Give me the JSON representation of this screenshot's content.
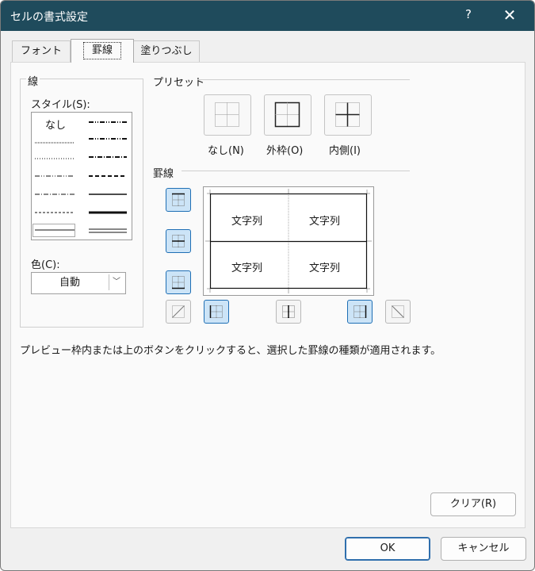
{
  "window": {
    "title": "セルの書式設定",
    "help_label": "?",
    "close_label": "✕"
  },
  "tabs": [
    {
      "label": "フォント"
    },
    {
      "label": "罫線"
    },
    {
      "label": "塗りつぶし"
    }
  ],
  "line_group": {
    "title": "線",
    "style_label": "スタイル(S):",
    "style_none": "なし",
    "color_label": "色(C):",
    "color_value": "自動"
  },
  "preset_group": {
    "title": "プリセット",
    "presets": [
      {
        "label": "なし(N)"
      },
      {
        "label": "外枠(O)"
      },
      {
        "label": "内側(I)"
      }
    ]
  },
  "border_group": {
    "title": "罫線",
    "cells": [
      "文字列",
      "文字列",
      "文字列",
      "文字列"
    ]
  },
  "note": "プレビュー枠内または上のボタンをクリックすると、選択した罫線の種類が適用されます。",
  "buttons": {
    "clear": "クリア(R)",
    "ok": "OK",
    "cancel": "キャンセル"
  },
  "colors": {
    "titlebar": "#1f4b5c",
    "selected_fill": "#cce4f7",
    "selected_border": "#1f6fb5"
  }
}
